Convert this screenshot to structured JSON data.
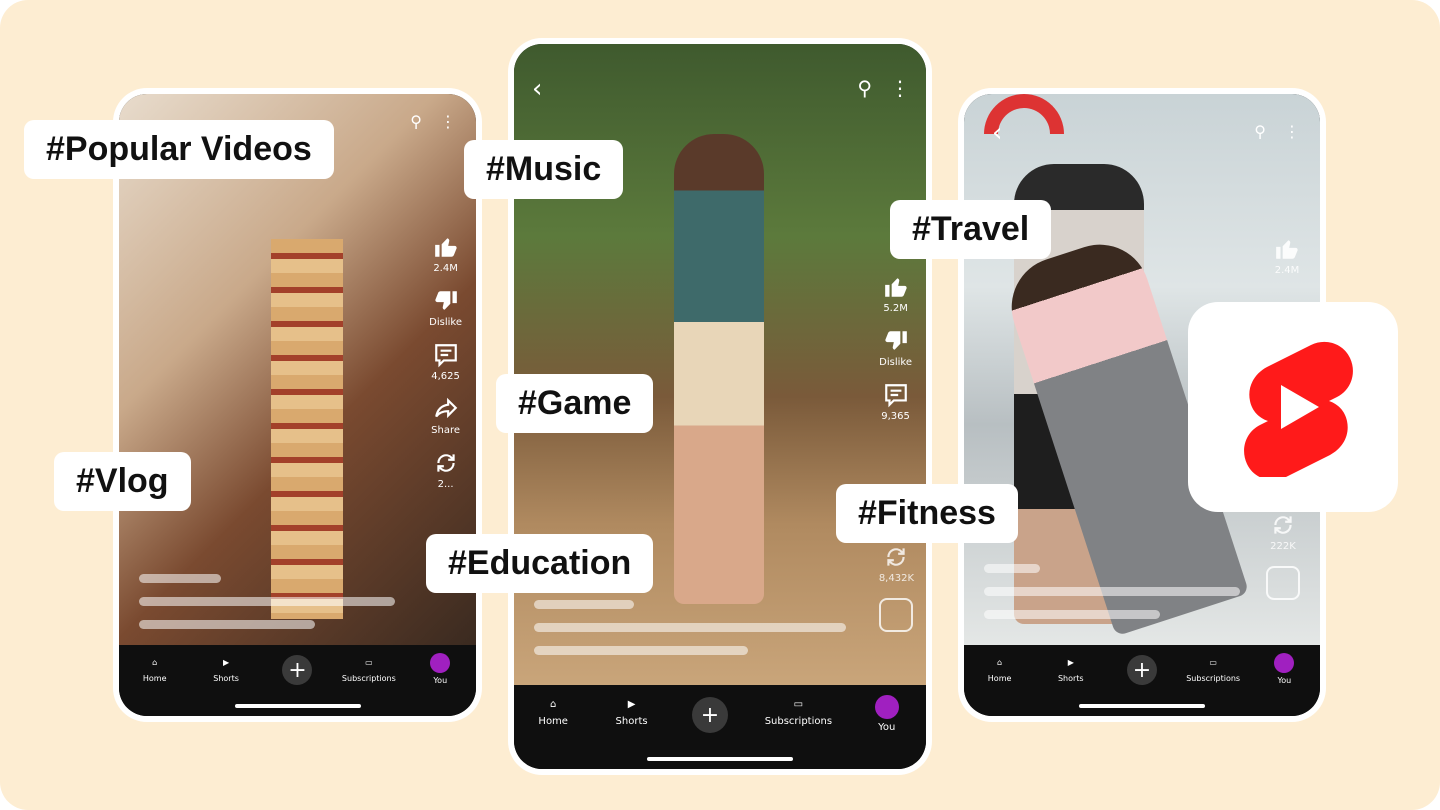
{
  "tags": [
    "#Popular Videos",
    "#Music",
    "#Travel",
    "#Game",
    "#Vlog",
    "#Fitness",
    "#Education"
  ],
  "nav": {
    "home": "Home",
    "shorts": "Shorts",
    "subscriptions": "Subscriptions",
    "you": "You"
  },
  "phones": [
    {
      "likes": "2.4M",
      "dislike": "Dislike",
      "comments": "4,625",
      "share": "Share",
      "remix": "2..."
    },
    {
      "likes": "5.2M",
      "dislike": "Dislike",
      "comments": "9,365",
      "remix": "8,432K"
    },
    {
      "likes": "2.4M",
      "remix": "222K"
    }
  ],
  "colors": {
    "background": "#fdedd2",
    "brand_red": "#ff1a1a",
    "nav_bg": "#0f0f0f",
    "avatar": "#a020c0"
  },
  "logo": "YouTube Shorts"
}
